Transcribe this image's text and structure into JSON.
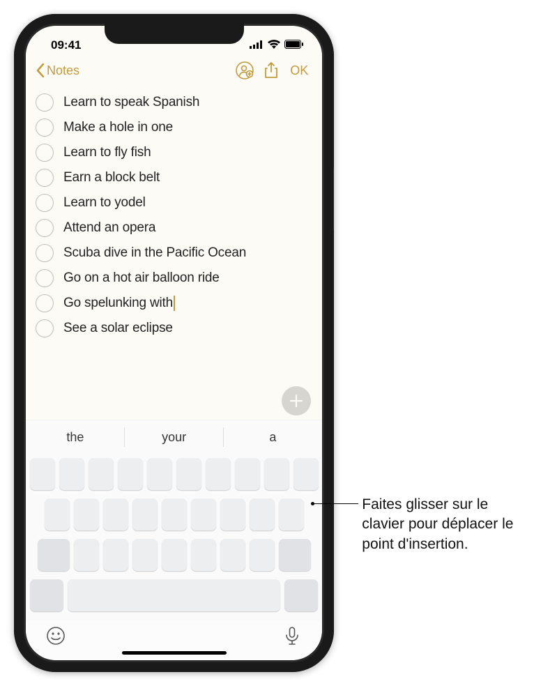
{
  "status": {
    "time": "09:41"
  },
  "nav": {
    "back_label": "Notes",
    "done_label": "OK"
  },
  "checklist": {
    "items": [
      {
        "text": "Learn to speak Spanish"
      },
      {
        "text": "Make a hole in one"
      },
      {
        "text": "Learn to fly fish"
      },
      {
        "text": "Earn a block belt"
      },
      {
        "text": "Learn to yodel"
      },
      {
        "text": "Attend an opera"
      },
      {
        "text": "Scuba dive in the Pacific Ocean"
      },
      {
        "text": "Go on a hot air balloon ride"
      },
      {
        "text": "Go spelunking with",
        "cursor": true
      },
      {
        "text": "See a solar eclipse"
      }
    ]
  },
  "predictions": [
    "the",
    "your",
    "a"
  ],
  "callout": {
    "text": "Faites glisser sur le clavier pour déplacer le point d'insertion."
  },
  "colors": {
    "accent": "#c19a3e"
  }
}
